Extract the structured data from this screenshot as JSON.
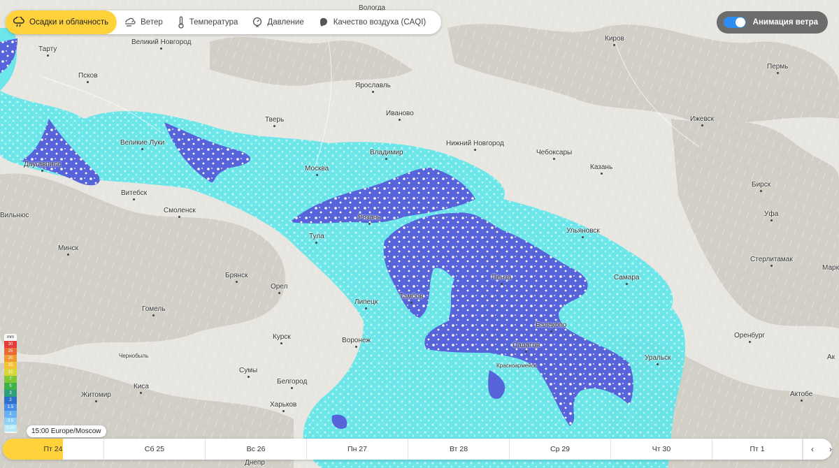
{
  "layers": [
    {
      "label": "Осадки и облачность",
      "icon": "cloud-rain-icon",
      "active": true
    },
    {
      "label": "Ветер",
      "icon": "wind-icon",
      "active": false
    },
    {
      "label": "Температура",
      "icon": "thermometer-icon",
      "active": false
    },
    {
      "label": "Давление",
      "icon": "pressure-gauge-icon",
      "active": false
    },
    {
      "label": "Качество воздуха (CAQI)",
      "icon": "leaf-icon",
      "active": false
    }
  ],
  "wind_toggle": {
    "label": "Анимация ветра",
    "on": true
  },
  "legend": {
    "unit": "mm",
    "steps": [
      {
        "v": "30",
        "c": "#e43b3b"
      },
      {
        "v": "25",
        "c": "#e86b37"
      },
      {
        "v": "20",
        "c": "#f09a36"
      },
      {
        "v": "15",
        "c": "#f5c33a"
      },
      {
        "v": "10",
        "c": "#d9d63a"
      },
      {
        "v": "7",
        "c": "#7fc63b"
      },
      {
        "v": "5",
        "c": "#3fb04a"
      },
      {
        "v": "3",
        "c": "#2f9e7a"
      },
      {
        "v": "2",
        "c": "#2f70c9"
      },
      {
        "v": "1.5",
        "c": "#4a8ee8"
      },
      {
        "v": "1",
        "c": "#6bb0f2"
      },
      {
        "v": "0.5",
        "c": "#8fd0f4"
      },
      {
        "v": "0.25",
        "c": "#b6eaf8"
      }
    ]
  },
  "time": "15:00 Europe/Moscow",
  "days": [
    "Пт 24",
    "Сб 25",
    "Вс 26",
    "Пн 27",
    "Вт 28",
    "Ср 29",
    "Чт 30",
    "Пт 1"
  ],
  "nav": {
    "prev": "‹",
    "next": "›"
  },
  "colors": {
    "accent": "#ffd23c",
    "snow_light": "#5fe7ea",
    "snow_heavy": "#5865d6",
    "toggle": "#2e8df0"
  },
  "cities": [
    {
      "name": "Вологда"
    },
    {
      "name": "Тарту"
    },
    {
      "name": "Великий Новгород"
    },
    {
      "name": "Киров"
    },
    {
      "name": "Псков"
    },
    {
      "name": "Ярославль"
    },
    {
      "name": "Пермь"
    },
    {
      "name": "Иваново"
    },
    {
      "name": "Тверь"
    },
    {
      "name": "Ижевск"
    },
    {
      "name": "Нижний Новгород"
    },
    {
      "name": "Великие Луки"
    },
    {
      "name": "Чебоксары"
    },
    {
      "name": "Владимир"
    },
    {
      "name": "Даугавпилс"
    },
    {
      "name": "Москва"
    },
    {
      "name": "Казань"
    },
    {
      "name": "Бирск"
    },
    {
      "name": "Витебск"
    },
    {
      "name": "Смоленск"
    },
    {
      "name": "Рязань"
    },
    {
      "name": "Уфа"
    },
    {
      "name": "Вильнюс"
    },
    {
      "name": "Ульяновск"
    },
    {
      "name": "Тула"
    },
    {
      "name": "Минск"
    },
    {
      "name": "Стерлитамак"
    },
    {
      "name": "Брянск"
    },
    {
      "name": "Пенза"
    },
    {
      "name": "Самара"
    },
    {
      "name": "Орел"
    },
    {
      "name": "Тамбов"
    },
    {
      "name": "Липецк"
    },
    {
      "name": "Гомель"
    },
    {
      "name": "Балаково"
    },
    {
      "name": "Курск"
    },
    {
      "name": "Воронеж"
    },
    {
      "name": "Оренбург"
    },
    {
      "name": "Саратов"
    },
    {
      "name": "Чернобыль"
    },
    {
      "name": "Уральск"
    },
    {
      "name": "Красноармейск"
    },
    {
      "name": "Сумы"
    },
    {
      "name": "Белгород"
    },
    {
      "name": "Киса"
    },
    {
      "name": "Житомир"
    },
    {
      "name": "Актобе"
    },
    {
      "name": "Харьков"
    },
    {
      "name": "Днепр"
    },
    {
      "name": "Марк"
    },
    {
      "name": "Ак"
    }
  ]
}
